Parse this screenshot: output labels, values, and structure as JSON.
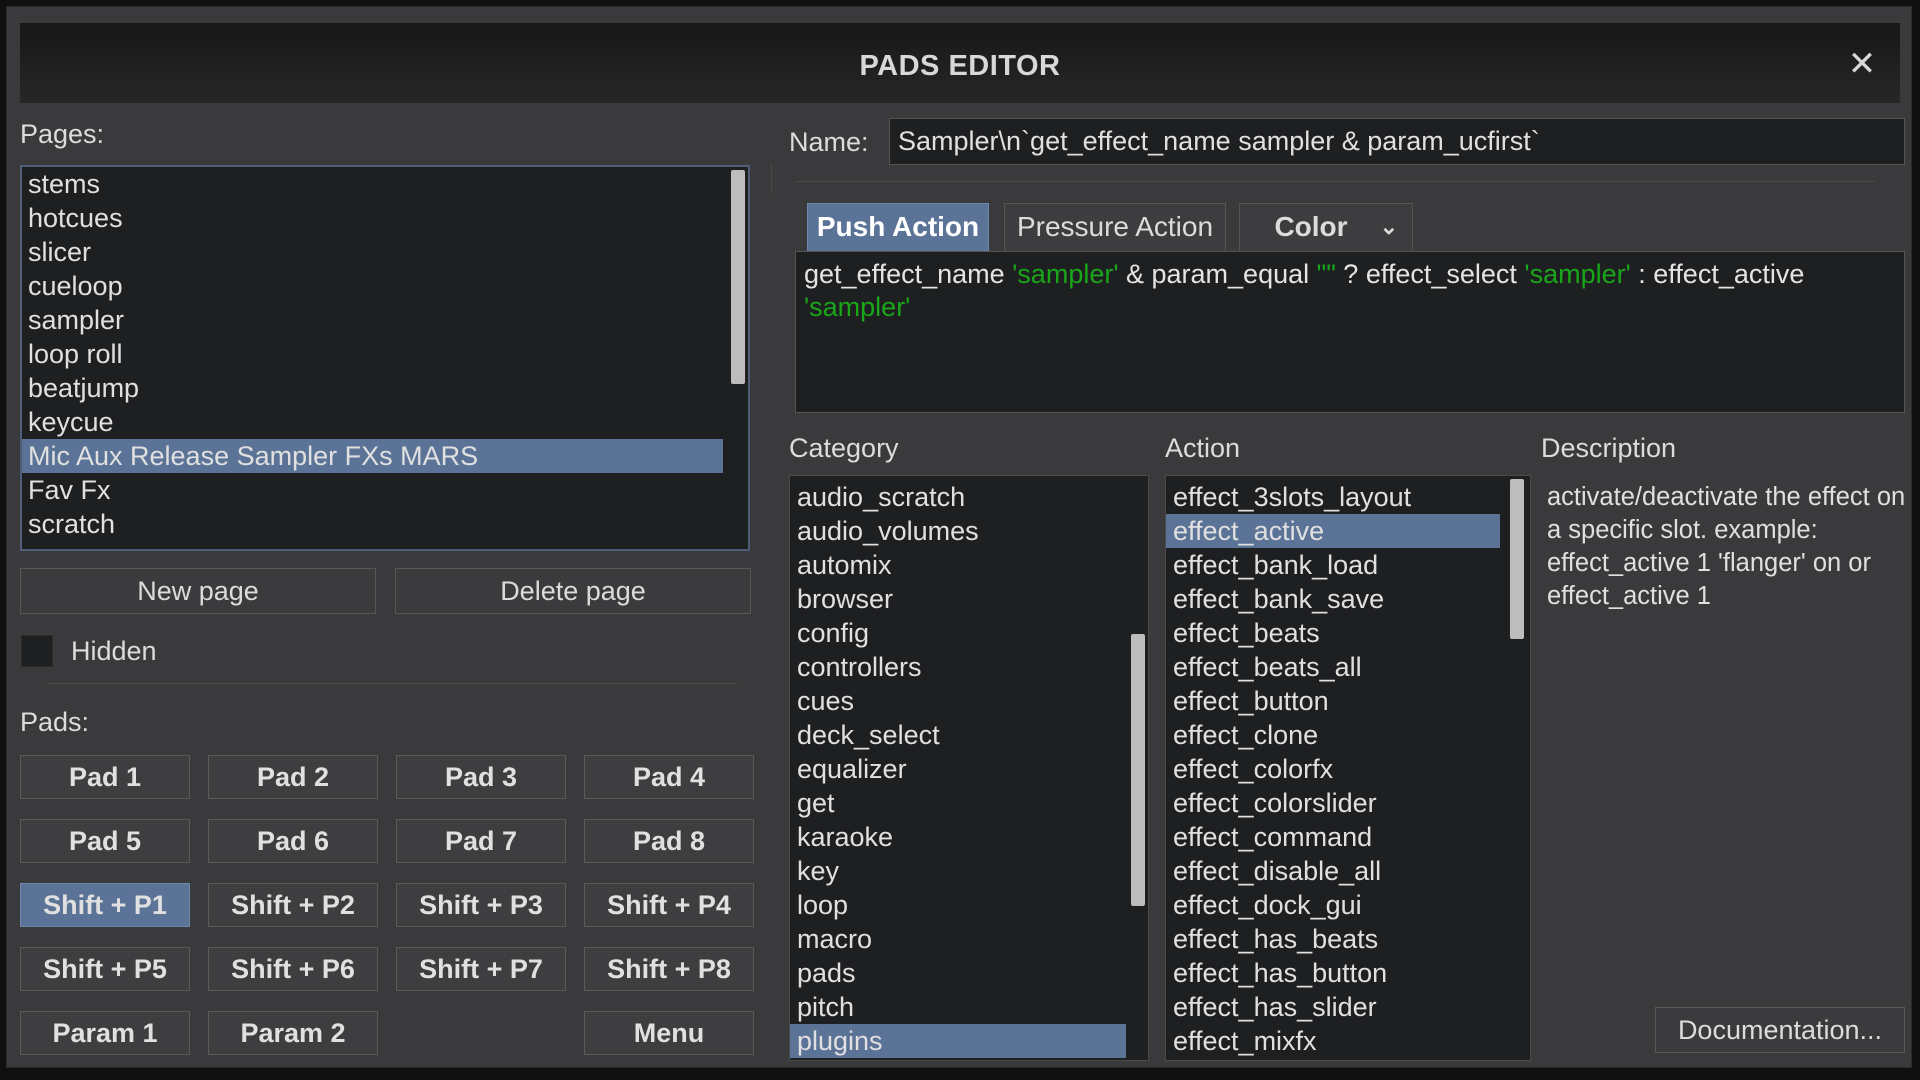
{
  "window": {
    "title": "PADS EDITOR",
    "close_glyph": "✕"
  },
  "pages": {
    "label": "Pages:",
    "items": [
      "stems",
      "hotcues",
      "slicer",
      "cueloop",
      "sampler",
      "loop roll",
      "beatjump",
      "keycue",
      "Mic Aux Release Sampler FXs MARS",
      "Fav Fx",
      "scratch"
    ],
    "selected": "Mic Aux Release Sampler FXs MARS",
    "new_page": "New page",
    "delete_page": "Delete page",
    "hidden_label": "Hidden",
    "hidden_checked": false
  },
  "pads": {
    "label": "Pads:",
    "buttons": [
      "Pad 1",
      "Pad 2",
      "Pad 3",
      "Pad 4",
      "Pad 5",
      "Pad 6",
      "Pad 7",
      "Pad 8",
      "Shift + P1",
      "Shift + P2",
      "Shift + P3",
      "Shift + P4",
      "Shift + P5",
      "Shift + P6",
      "Shift + P7",
      "Shift + P8",
      "Param 1",
      "Param 2",
      "Menu"
    ],
    "selected": "Shift + P1"
  },
  "name": {
    "label": "Name:",
    "value": "Sampler\\n`get_effect_name sampler & param_ucfirst`"
  },
  "tabs": {
    "push_action": "Push Action",
    "pressure_action": "Pressure Action",
    "color": "Color",
    "active": "Push Action"
  },
  "script": {
    "p1": "get_effect_name ",
    "s1": "'sampler'",
    "p2": " & param_equal ",
    "s2": "\"\"",
    "p3": " ? effect_select ",
    "s3": "'sampler'",
    "p4": " : effect_active ",
    "s4": "'sampler'"
  },
  "category": {
    "label": "Category",
    "items": [
      "audio_scratch",
      "audio_volumes",
      "automix",
      "browser",
      "config",
      "controllers",
      "cues",
      "deck_select",
      "equalizer",
      "get",
      "karaoke",
      "key",
      "loop",
      "macro",
      "pads",
      "pitch",
      "plugins"
    ],
    "selected": "plugins"
  },
  "action": {
    "label": "Action",
    "items": [
      "effect_3slots_layout",
      "effect_active",
      "effect_bank_load",
      "effect_bank_save",
      "effect_beats",
      "effect_beats_all",
      "effect_button",
      "effect_clone",
      "effect_colorfx",
      "effect_colorslider",
      "effect_command",
      "effect_disable_all",
      "effect_dock_gui",
      "effect_has_beats",
      "effect_has_button",
      "effect_has_slider",
      "effect_mixfx"
    ],
    "selected": "effect_active"
  },
  "description": {
    "label": "Description",
    "text": "activate/deactivate the effect on a specific slot. example: effect_active 1 'flanger' on or effect_active 1"
  },
  "documentation_button": "Documentation...",
  "colors": {
    "accent": "#5b7396",
    "string": "#19a619",
    "field_bg": "#1e1f21",
    "panel_bg": "#3a3a3c"
  }
}
